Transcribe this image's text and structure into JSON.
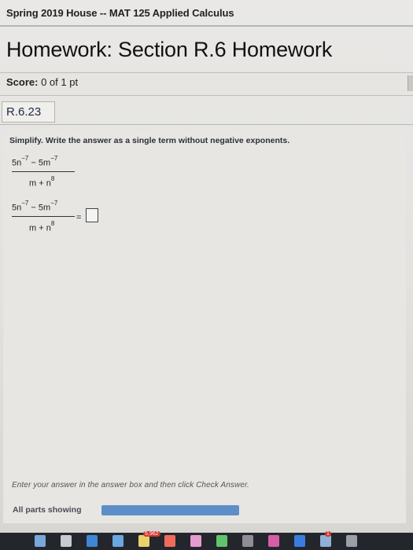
{
  "header": {
    "course_title": "Spring 2019 House -- MAT 125 Applied Calculus",
    "homework_title": "Homework: Section R.6 Homework"
  },
  "score": {
    "label": "Score:",
    "value": "0 of 1 pt"
  },
  "question": {
    "id": "R.6.23",
    "instruction": "Simplify. Write the answer as a single term without negative exponents.",
    "expression": {
      "num_term1_coef": "5n",
      "num_exp1": "−7",
      "num_minus": " − 5m",
      "num_exp2": "−7",
      "den_base": "m + n",
      "den_exp": "8"
    },
    "equals": "=",
    "answer_value": ""
  },
  "footer": {
    "hint": "Enter your answer in the answer box and then click Check Answer.",
    "parts_label": "All parts showing",
    "parts_progress": 1.0
  },
  "colors": {
    "progress_fill": "#5d8ec7",
    "taskbar": "#24262d"
  },
  "taskbar": {
    "icons": [
      "finder-icon",
      "launchpad-icon",
      "safari-icon",
      "mail-icon",
      "notes-icon",
      "calendar-icon",
      "photos-icon",
      "messages-icon",
      "settings-icon",
      "itunes-icon",
      "app-store-icon",
      "preview-icon",
      "trash-icon"
    ],
    "badges": [
      "5,962",
      "1"
    ]
  }
}
